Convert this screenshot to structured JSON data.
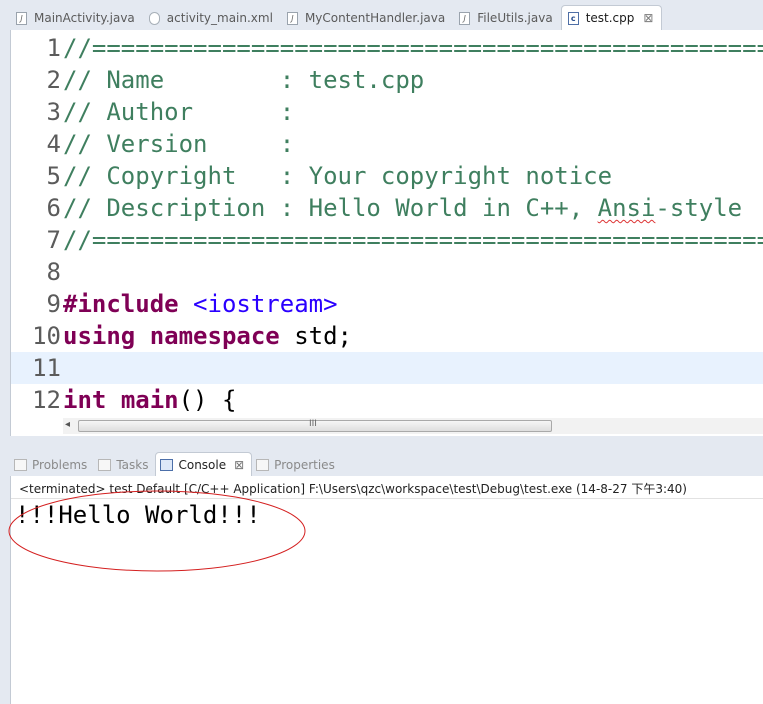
{
  "editor_tabs": [
    {
      "label": "MainActivity.java",
      "icon": "java-file-icon",
      "glyph": "J"
    },
    {
      "label": "activity_main.xml",
      "icon": "xml-file-icon",
      "glyph": ""
    },
    {
      "label": "MyContentHandler.java",
      "icon": "java-file-icon",
      "glyph": "J"
    },
    {
      "label": "FileUtils.java",
      "icon": "java-file-icon",
      "glyph": "J"
    },
    {
      "label": "test.cpp",
      "icon": "cpp-file-icon",
      "glyph": "c",
      "active": true,
      "close": "⊠"
    }
  ],
  "editor": {
    "current_line": 11,
    "lines": [
      {
        "n": "1",
        "segments": [
          {
            "t": "//=================================================",
            "c": "cmt"
          }
        ]
      },
      {
        "n": "2",
        "segments": [
          {
            "t": "// Name        : test.cpp",
            "c": "cmt"
          }
        ]
      },
      {
        "n": "3",
        "segments": [
          {
            "t": "// Author      :",
            "c": "cmt"
          }
        ]
      },
      {
        "n": "4",
        "segments": [
          {
            "t": "// Version     :",
            "c": "cmt"
          }
        ]
      },
      {
        "n": "5",
        "segments": [
          {
            "t": "// Copyright   : Your copyright notice",
            "c": "cmt"
          }
        ]
      },
      {
        "n": "6",
        "segments": [
          {
            "t": "// Description : Hello World in C++, ",
            "c": "cmt"
          },
          {
            "t": "Ansi",
            "c": "cmt squiggle"
          },
          {
            "t": "-style",
            "c": "cmt"
          }
        ]
      },
      {
        "n": "7",
        "segments": [
          {
            "t": "//=================================================",
            "c": "cmt"
          }
        ]
      },
      {
        "n": "8",
        "segments": []
      },
      {
        "n": "9",
        "segments": [
          {
            "t": "#include",
            "c": "kw"
          },
          {
            "t": " ",
            "c": "plain"
          },
          {
            "t": "<iostream>",
            "c": "str"
          }
        ]
      },
      {
        "n": "10",
        "segments": [
          {
            "t": "using",
            "c": "kw"
          },
          {
            "t": " ",
            "c": "plain"
          },
          {
            "t": "namespace",
            "c": "kw"
          },
          {
            "t": " std;",
            "c": "plain"
          }
        ]
      },
      {
        "n": "11",
        "segments": []
      },
      {
        "n": "12",
        "segments": [
          {
            "t": "int",
            "c": "kw"
          },
          {
            "t": " ",
            "c": "plain"
          },
          {
            "t": "main",
            "c": "kw"
          },
          {
            "t": "() {",
            "c": "plain"
          }
        ]
      }
    ]
  },
  "scrollbar": {
    "grip": "III",
    "left_arrow": "◂"
  },
  "console_tabs": [
    {
      "label": "Problems",
      "icon": "problems-icon"
    },
    {
      "label": "Tasks",
      "icon": "tasks-icon"
    },
    {
      "label": "Console",
      "icon": "console-icon",
      "active": true,
      "close": "⊠"
    },
    {
      "label": "Properties",
      "icon": "properties-icon"
    }
  ],
  "console": {
    "status": "<terminated> test Default [C/C++ Application] F:\\Users\\qzc\\workspace\\test\\Debug\\test.exe (14-8-27 下午3:40)",
    "output": "!!!Hello World!!!",
    "annotation_color": "#d42020"
  }
}
